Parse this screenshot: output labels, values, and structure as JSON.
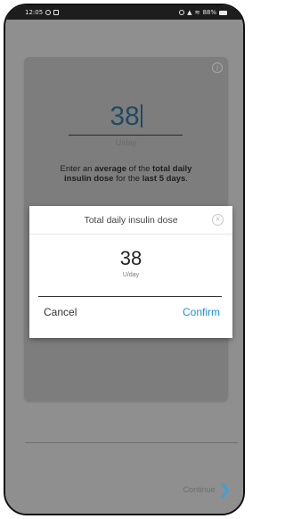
{
  "status_bar": {
    "time": "12:05",
    "battery_text": "88%"
  },
  "main_card": {
    "dose_value": "38",
    "dose_unit": "U/day",
    "instruction": {
      "part1": "Enter an ",
      "bold1": "average",
      "part2": " of the ",
      "bold2": "total daily insulin dose",
      "part3": " for the ",
      "bold3": "last 5 days",
      "part4": "."
    }
  },
  "dialog": {
    "title": "Total daily insulin dose",
    "value": "38",
    "unit": "U/day",
    "cancel_label": "Cancel",
    "confirm_label": "Confirm"
  },
  "footer": {
    "continue_label": "Continue"
  },
  "colors": {
    "accent": "#1e8fd0",
    "value_blue": "#1f4b63"
  },
  "icons": [
    "info-icon",
    "close-icon",
    "chevron-right-icon",
    "battery-icon",
    "signal-icon",
    "wifi-icon"
  ]
}
